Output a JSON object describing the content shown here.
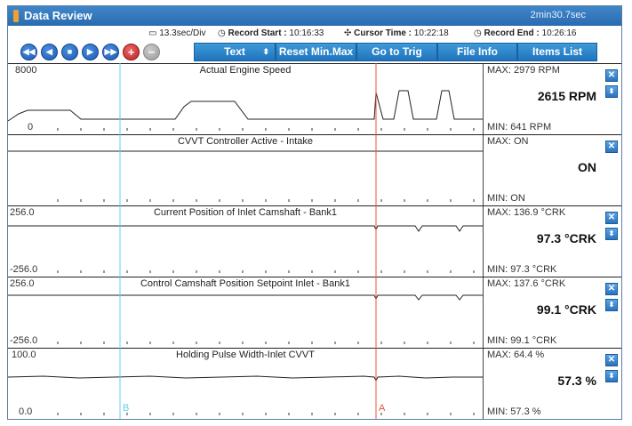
{
  "window": {
    "title": "Data Review",
    "elapsed": "2min30.7sec"
  },
  "info": {
    "div": "13.3sec/Div",
    "record_start_label": "Record Start :",
    "record_start": "10:16:33",
    "cursor_time_label": "Cursor Time :",
    "cursor_time": "10:22:18",
    "record_end_label": "Record End :",
    "record_end": "10:26:16"
  },
  "toolbar": {
    "text_select": "Text",
    "reset_minmax": "Reset Min.Max",
    "go_to_trig": "Go to Trig",
    "file_info": "File Info",
    "items_list": "Items List"
  },
  "cursors": {
    "b_label": "B",
    "a_label": "A"
  },
  "panels": [
    {
      "title": "Actual Engine Speed",
      "y_max": "8000",
      "y_min": "0",
      "max": "MAX:  2979 RPM",
      "value": "2615 RPM",
      "min": "MIN:   641 RPM"
    },
    {
      "title": "CVVT Controller Active - Intake",
      "y_max": "",
      "y_min": "",
      "max": "MAX: ON",
      "value": "ON",
      "min": "MIN: ON"
    },
    {
      "title": "Current Position of Inlet Camshaft - Bank1",
      "y_max": "256.0",
      "y_min": "-256.0",
      "max": "MAX: 136.9 °CRK",
      "value": "97.3 °CRK",
      "min": "MIN:  97.3 °CRK"
    },
    {
      "title": "Control Camshaft Position Setpoint Inlet - Bank1",
      "y_max": "256.0",
      "y_min": "-256.0",
      "max": "MAX: 137.6 °CRK",
      "value": "99.1 °CRK",
      "min": "MIN:  99.1 °CRK"
    },
    {
      "title": "Holding Pulse Width-Inlet CVVT",
      "y_max": "100.0",
      "y_min": "0.0",
      "max": "MAX:  64.4 %",
      "value": "57.3 %",
      "min": "MIN:  57.3 %"
    }
  ],
  "colors": {
    "titlebar": "#2a6bb0",
    "toolbar_button": "#1f74bd",
    "cursor_a": "#e8553a",
    "cursor_b": "#5fcfe8"
  },
  "icons": {
    "rewind": "double-left-arrow",
    "prev": "left-arrow",
    "stop": "square",
    "next": "right-arrow",
    "fast_forward": "double-right-arrow",
    "add": "plus",
    "remove": "minus"
  }
}
